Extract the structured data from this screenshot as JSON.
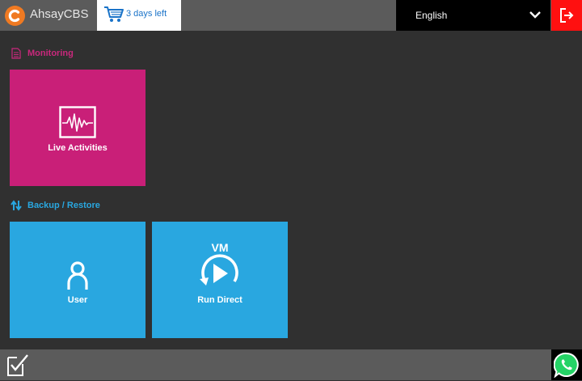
{
  "header": {
    "brand_name": "AhsayCBS",
    "license_text": "3 days left",
    "language": "English"
  },
  "sections": {
    "monitoring": {
      "title": "Monitoring",
      "tiles": {
        "live_activities": "Live Activities"
      }
    },
    "backup_restore": {
      "title": "Backup / Restore",
      "tiles": {
        "user": "User",
        "run_direct": "Run Direct",
        "run_direct_tag": "VM"
      }
    }
  },
  "colors": {
    "topbar": "#5b5b5b",
    "background": "#303030",
    "monitoring_accent": "#c91f78",
    "backup_accent": "#29a7e0",
    "logout": "#ff1010",
    "brand_logo": "#f07a22"
  },
  "icons": {
    "brand": "ahsay-logo-icon",
    "license": "cart-icon",
    "language": "chevron-down-icon",
    "logout": "logout-icon",
    "monitoring": "document-icon",
    "backup": "sync-arrows-icon",
    "live_activities": "activity-monitor-icon",
    "user": "user-icon",
    "run_direct": "vm-run-direct-icon",
    "tasks": "checklist-icon",
    "chat": "whatsapp-icon"
  }
}
